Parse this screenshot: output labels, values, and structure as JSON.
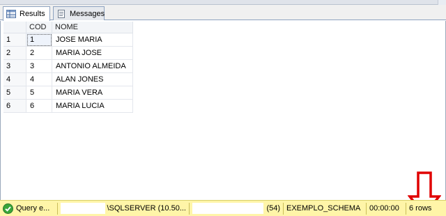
{
  "tabs": {
    "results_label": "Results",
    "messages_label": "Messages"
  },
  "grid": {
    "columns": [
      "COD",
      "NOME"
    ],
    "rows": [
      {
        "row_number": "1",
        "cod": "1",
        "nome": "JOSE MARIA"
      },
      {
        "row_number": "2",
        "cod": "2",
        "nome": "MARIA JOSE"
      },
      {
        "row_number": "3",
        "cod": "3",
        "nome": "ANTONIO ALMEIDA"
      },
      {
        "row_number": "4",
        "cod": "4",
        "nome": "ALAN JONES"
      },
      {
        "row_number": "5",
        "cod": "5",
        "nome": "MARIA VERA"
      },
      {
        "row_number": "6",
        "cod": "6",
        "nome": "MARIA LUCIA"
      }
    ]
  },
  "status_bar": {
    "query_status": "Query e...",
    "server": "\\SQLSERVER (10.50...",
    "user_spid": "(54)",
    "database": "EXEMPLO_SCHEMA",
    "elapsed_time": "00:00:00",
    "row_count": "6 rows"
  },
  "colors": {
    "status_bar_bg": "#fff5a8",
    "arrow": "#e00000",
    "ok_icon": "#3aa63a",
    "tab_border": "#8da2c0"
  },
  "icons": {
    "results_tab": "grid-icon",
    "messages_tab": "document-icon",
    "status_ok": "check-circle-icon",
    "annotation": "down-arrow-icon"
  }
}
